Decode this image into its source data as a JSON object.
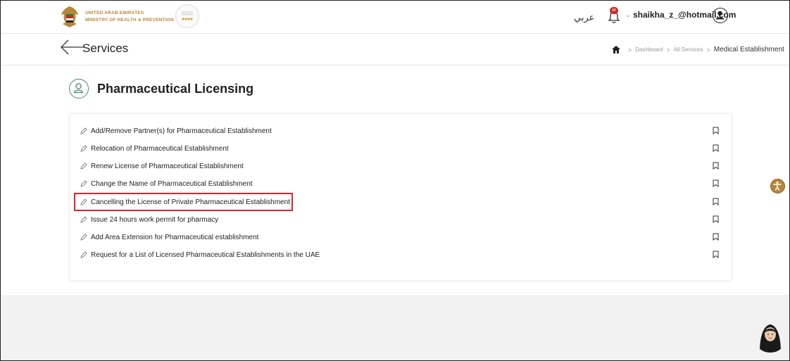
{
  "header": {
    "ministry_line1": "UNITED ARAB EMIRATES",
    "ministry_line2": "MINISTRY OF HEALTH & PREVENTION",
    "language_toggle": "عربي",
    "notification_count": "88",
    "user_email": "shaikha_z_@hotmail.com"
  },
  "subbar": {
    "title": "Services",
    "breadcrumb": {
      "dashboard": "Dashboard",
      "all_services": "All Services",
      "current": "Medical Establishment"
    }
  },
  "main": {
    "title": "Pharmaceutical Licensing",
    "services": [
      {
        "label": "Add/Remove Partner(s) for Pharmaceutical Establishment"
      },
      {
        "label": "Relocation of Pharmaceutical Establishment"
      },
      {
        "label": "Renew License of Pharmaceutical Establishment"
      },
      {
        "label": "Change the Name of Pharmaceutical Establishment"
      },
      {
        "label": "Cancelling the License of Private Pharmaceutical Establishment"
      },
      {
        "label": "Issue 24 hours work permit for pharmacy"
      },
      {
        "label": "Add Area Extension for Pharmaceutical establishment"
      },
      {
        "label": "Request for a List of Licensed Pharmaceutical Establishments in the UAE"
      }
    ]
  },
  "colors": {
    "brand_gold": "#b8863b",
    "highlight_red": "#d9262c",
    "icon_green": "#4a8a68"
  },
  "icons": [
    "uae-emblem-icon",
    "star-rating-icon",
    "bell-icon",
    "user-avatar-icon",
    "back-arrow-icon",
    "home-icon",
    "user-outline-icon",
    "pencil-icon",
    "bookmark-icon",
    "accessibility-icon",
    "assistant-avatar-icon"
  ]
}
